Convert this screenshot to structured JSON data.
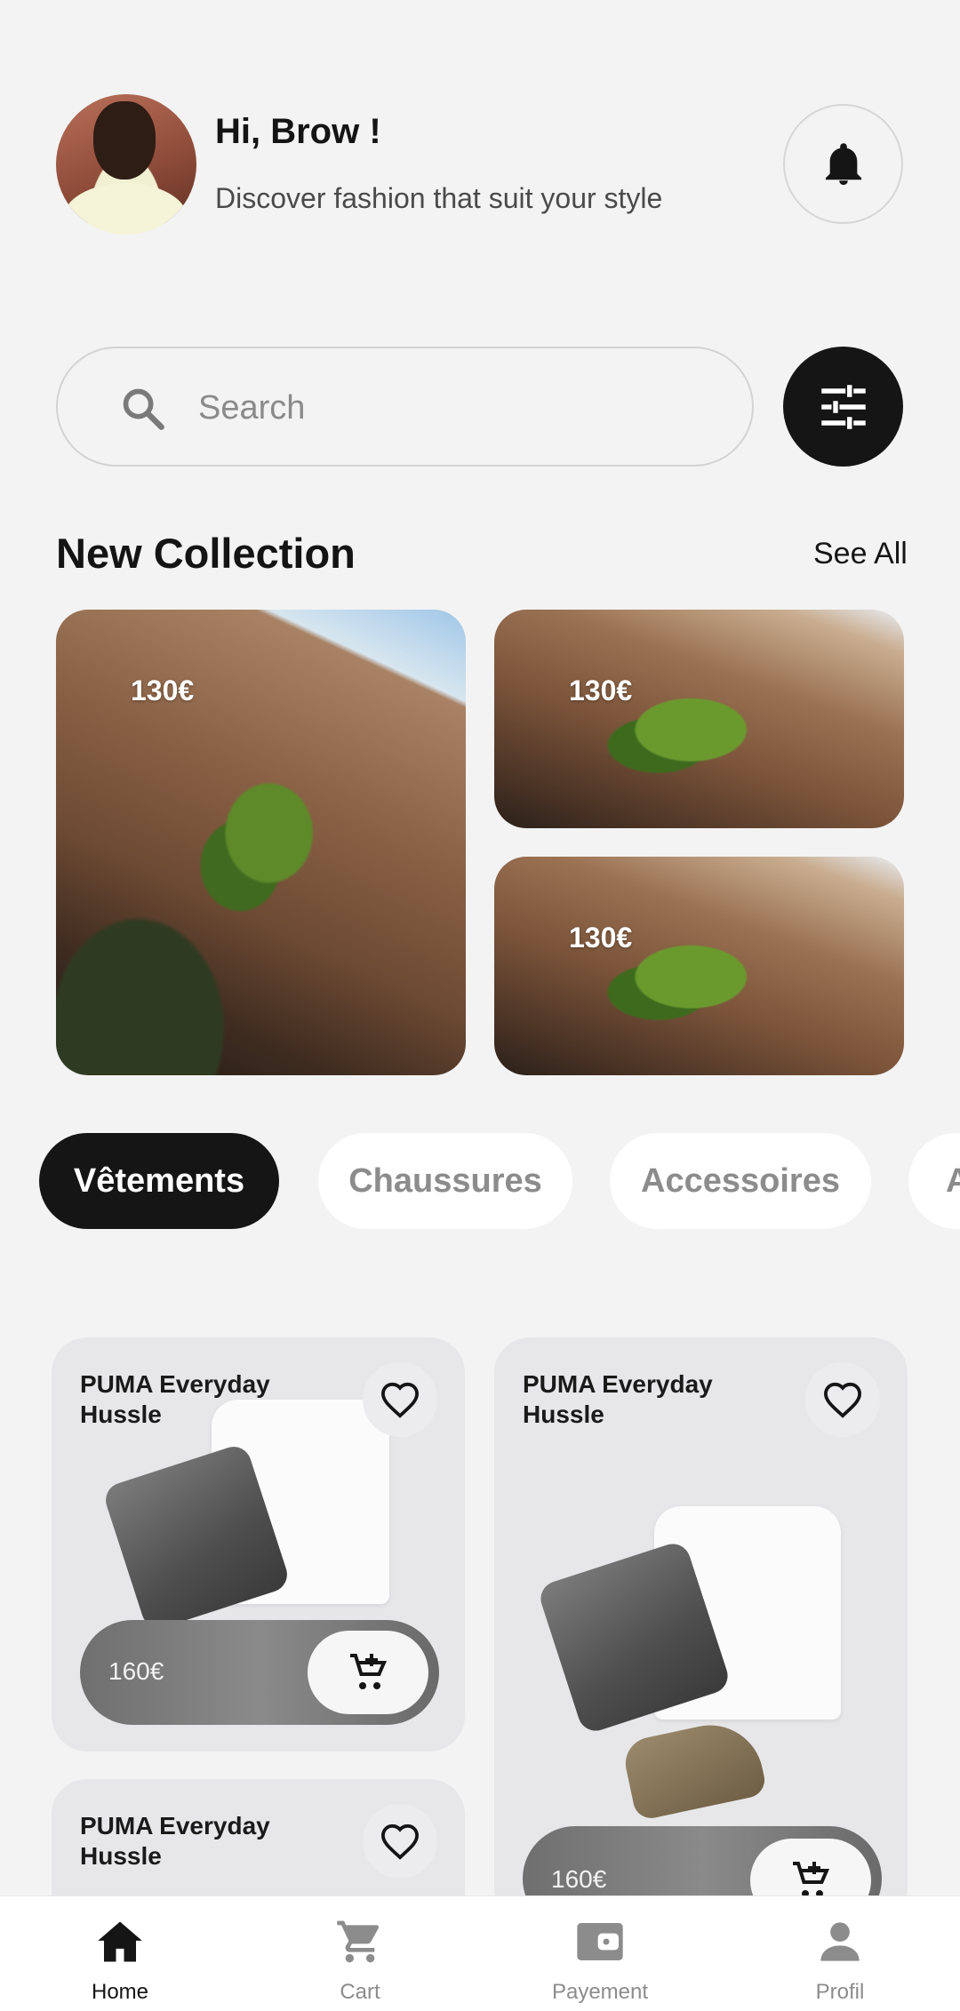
{
  "header": {
    "greeting": "Hi, Brow !",
    "subtitle": "Discover fashion that suit your style"
  },
  "search": {
    "placeholder": "Search",
    "value": ""
  },
  "collection": {
    "title": "New Collection",
    "see_all": "See All",
    "items": [
      {
        "price": "130€"
      },
      {
        "price": "130€"
      },
      {
        "price": "130€"
      }
    ]
  },
  "categories": [
    {
      "label": "Vêtements",
      "active": true
    },
    {
      "label": "Chaussures",
      "active": false
    },
    {
      "label": "Accessoires",
      "active": false
    },
    {
      "label": "A",
      "active": false
    }
  ],
  "products": [
    {
      "name": "PUMA Everyday Hussle",
      "price": "160€"
    },
    {
      "name": "PUMA Everyday Hussle",
      "price": "160€"
    },
    {
      "name": "PUMA Everyday Hussle",
      "price": ""
    }
  ],
  "bottom_nav": [
    {
      "label": "Home",
      "icon": "home-icon",
      "active": true
    },
    {
      "label": "Cart",
      "icon": "cart-icon",
      "active": false
    },
    {
      "label": "Payement",
      "icon": "wallet-icon",
      "active": false
    },
    {
      "label": "Profil",
      "icon": "person-icon",
      "active": false
    }
  ],
  "colors": {
    "background": "#f3f3f3",
    "accent_dark": "#151515",
    "muted_text": "#8c8c8c"
  }
}
